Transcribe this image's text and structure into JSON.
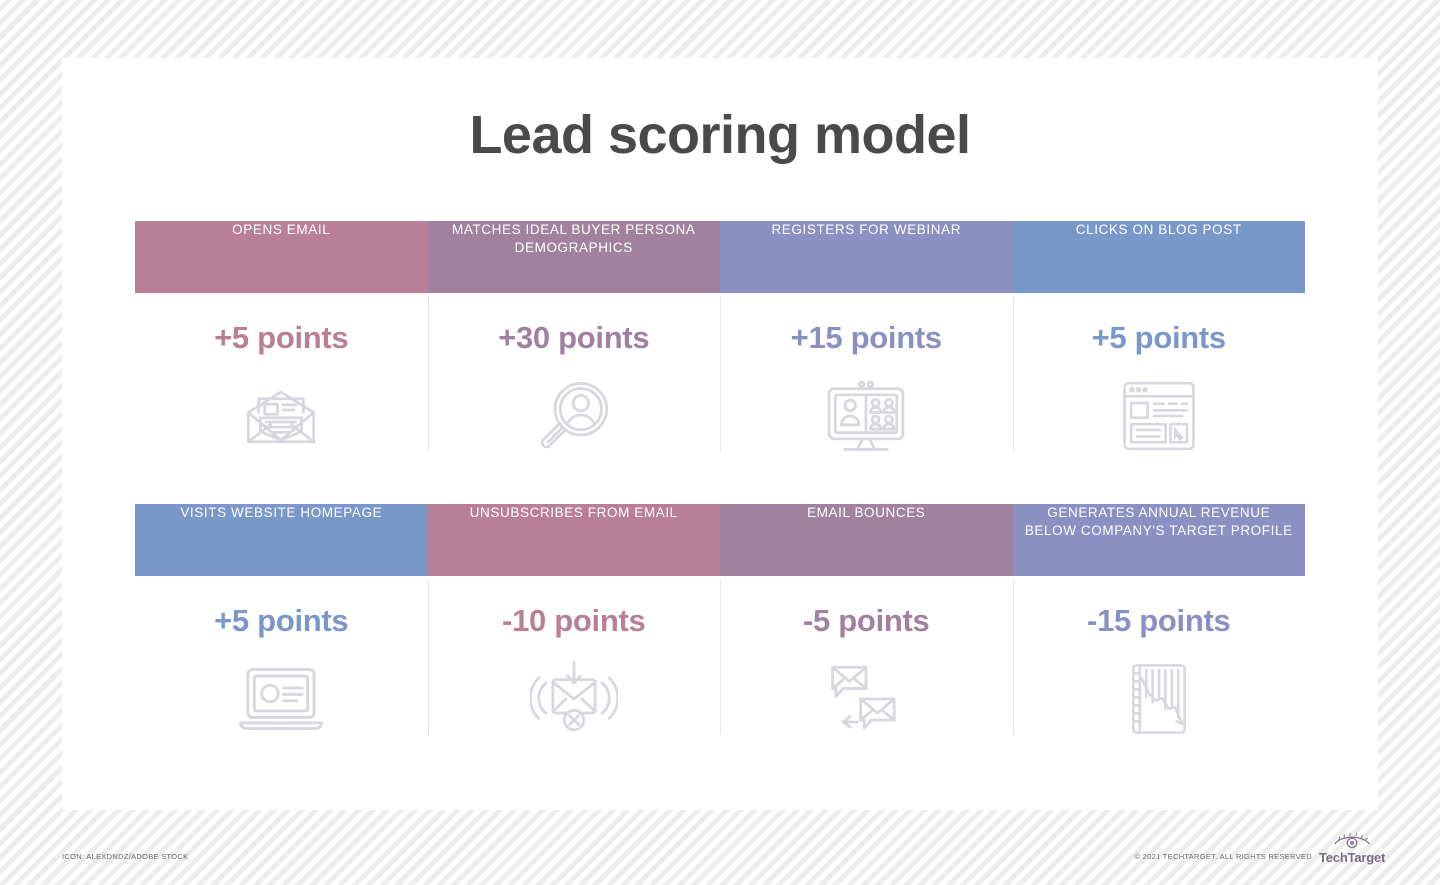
{
  "page": {
    "title": "Lead scoring model"
  },
  "colors": {
    "rose": "#b97f96",
    "purple": "#a2819f",
    "indigo": "#8a90c2",
    "blue": "#7a97c9",
    "title": "#4a4a4d",
    "icon": "#d6d8dd",
    "footer_text": "#6f5f6c",
    "card_background": "#ffffff"
  },
  "rows": [
    {
      "cells": [
        {
          "label": "OPENS EMAIL",
          "points": "+5 points",
          "color": "#b97f96",
          "icon": "open-envelope-letter-icon"
        },
        {
          "label": "MATCHES IDEAL BUYER PERSONA DEMOGRAPHICS",
          "points": "+30 points",
          "color": "#a2819f",
          "icon": "magnifier-person-icon"
        },
        {
          "label": "REGISTERS FOR WEBINAR",
          "points": "+15 points",
          "color": "#8a90c2",
          "icon": "monitor-video-conference-icon"
        },
        {
          "label": "CLICKS ON BLOG POST",
          "points": "+5 points",
          "color": "#7a97c9",
          "icon": "browser-article-cursor-icon"
        }
      ]
    },
    {
      "cells": [
        {
          "label": "VISITS WEBSITE HOMEPAGE",
          "points": "+5 points",
          "color": "#7a97c9",
          "icon": "laptop-webpage-icon"
        },
        {
          "label": "UNSUBSCRIBES FROM EMAIL",
          "points": "-10 points",
          "color": "#b97f96",
          "icon": "envelope-unsubscribe-icon"
        },
        {
          "label": "EMAIL BOUNCES",
          "points": "-5 points",
          "color": "#a2819f",
          "icon": "envelopes-bounce-icon"
        },
        {
          "label": "GENERATES ANNUAL REVENUE BELOW COMPANY'S TARGET PROFILE",
          "points": "-15 points",
          "color": "#8a90c2",
          "icon": "declining-bar-chart-icon"
        }
      ]
    }
  ],
  "footer": {
    "credit": "ICON: ALEXDNDZ/ADOBE STOCK",
    "copyright": "© 2021 TECHTARGET. ALL RIGHTS RESERVED",
    "logo_text": "TechTarget",
    "logo_mark": "eye-icon"
  }
}
